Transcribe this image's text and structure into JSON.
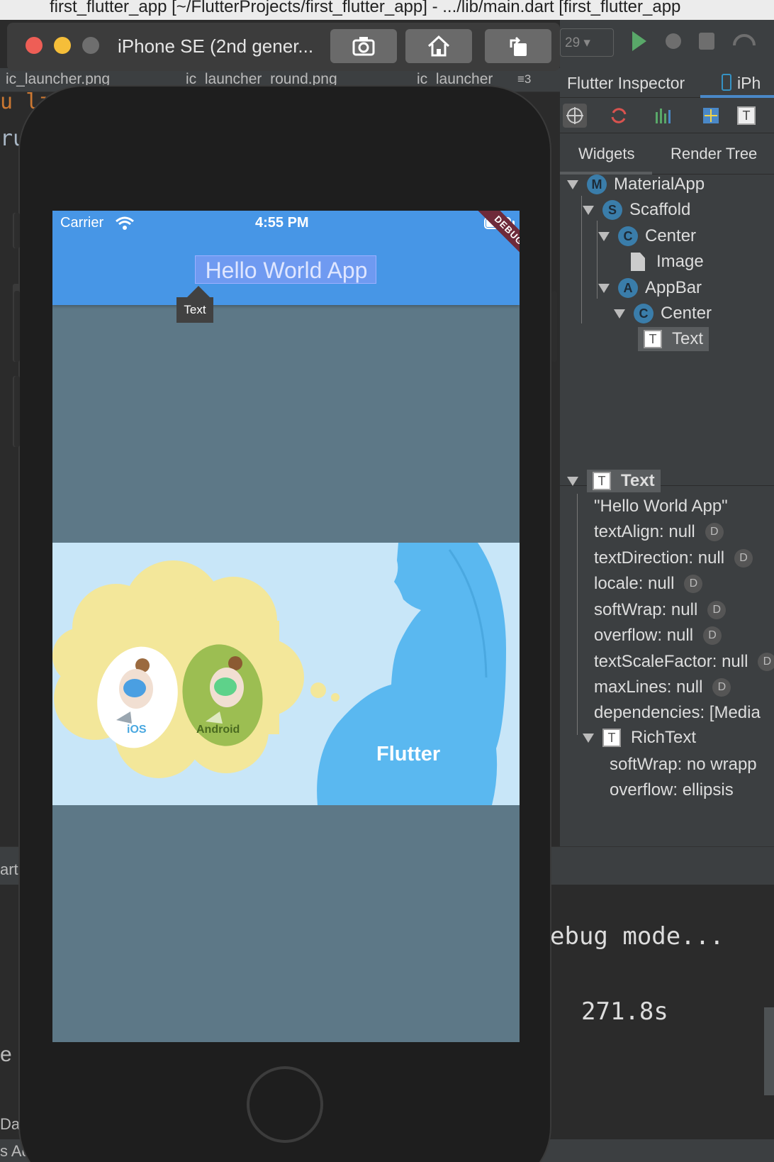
{
  "ide": {
    "window_title": "first_flutter_app [~/FlutterProjects/first_flutter_app] - .../lib/main.dart [first_flutter_app",
    "editor_tabs": [
      "ic_launcher.png",
      "ic_launcher_round.png",
      "ic_launcher"
    ],
    "tab_overflow": "≡3",
    "sdk_select": "29",
    "console_line1": "ebug mode...",
    "console_line2": "271.8s",
    "side_labels": [
      "art",
      "e",
      "Dart",
      "s Add"
    ]
  },
  "simulator": {
    "device_name": "iPhone SE (2nd gener...",
    "toolbar_buttons": [
      {
        "name": "screenshot",
        "icon": "camera-icon"
      },
      {
        "name": "home",
        "icon": "home-icon"
      },
      {
        "name": "rotate",
        "icon": "rotate-icon"
      }
    ]
  },
  "app": {
    "status": {
      "carrier": "Carrier",
      "time": "4:55 PM"
    },
    "appbar_title": "Hello World App",
    "debug_banner": "DEBUG",
    "tooltip": "Text",
    "image_labels": {
      "ios": "iOS",
      "android": "Android",
      "flutter": "Flutter"
    },
    "colors": {
      "appbar": "#4796e6",
      "body": "#5d7887",
      "image_bg": "#c8e6f8",
      "debug": "#6e2a3a"
    }
  },
  "inspector": {
    "title": "Flutter Inspector",
    "device_tab": "iPh",
    "subtabs": [
      "Widgets",
      "Render Tree"
    ],
    "tree": [
      {
        "badge": "M",
        "label": "MaterialApp"
      },
      {
        "badge": "S",
        "label": "Scaffold"
      },
      {
        "badge": "C",
        "label": "Center"
      },
      {
        "badge": "",
        "label": "Image"
      },
      {
        "badge": "A",
        "label": "AppBar"
      },
      {
        "badge": "C",
        "label": "Center"
      },
      {
        "badge": "T",
        "label": "Text"
      }
    ],
    "details_title": "Text",
    "details": [
      {
        "text": "\"Hello World App\"",
        "d": false
      },
      {
        "text": "textAlign: null",
        "d": true
      },
      {
        "text": "textDirection: null",
        "d": true
      },
      {
        "text": "locale: null",
        "d": true
      },
      {
        "text": "softWrap: null",
        "d": true
      },
      {
        "text": "overflow: null",
        "d": true
      },
      {
        "text": "textScaleFactor: null",
        "d": true
      },
      {
        "text": "maxLines: null",
        "d": true
      },
      {
        "text": "dependencies: [Media",
        "d": false
      }
    ],
    "richtext_title": "RichText",
    "richtext_details": [
      "softWrap: no wrapp",
      "overflow: ellipsis"
    ],
    "badge_d": "D"
  }
}
